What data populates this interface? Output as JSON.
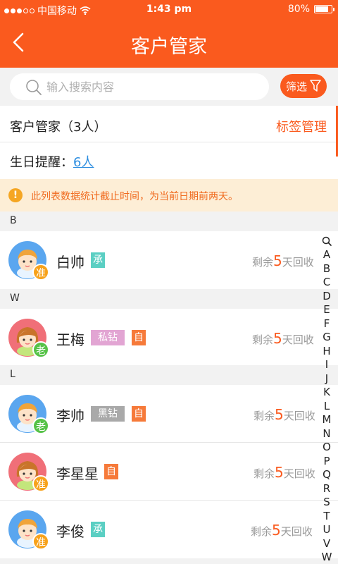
{
  "status_bar": {
    "carrier": "中国移动",
    "time": "1:43 pm",
    "battery_text": "80%",
    "battery_level": 0.8,
    "signal_dots_filled": 3,
    "signal_dots_total": 5,
    "icons": [
      "signal-dots-icon",
      "wifi-icon",
      "battery-icon"
    ]
  },
  "nav": {
    "title": "客户管家",
    "back_icon": "chevron-left-icon"
  },
  "search": {
    "placeholder": "输入搜索内容",
    "value": "",
    "filter_label": "筛选",
    "icons": [
      "search-icon",
      "filter-funnel-icon"
    ]
  },
  "summary": {
    "title": "客户管家（3人）",
    "tag_manage": "标签管理",
    "birthday_label": "生日提醒：",
    "birthday_count": "6人"
  },
  "notice": {
    "icon": "!",
    "text": "此列表数据统计截止时间，为当前日期前两天。"
  },
  "sections": [
    {
      "letter": "B",
      "items": [
        {
          "name": "白帅",
          "avatar_badge": "准",
          "tags": [
            "承"
          ],
          "remain_prefix": "剩余",
          "remain_days": "5",
          "remain_suffix": "天回收"
        }
      ]
    },
    {
      "letter": "W",
      "items": [
        {
          "name": "王梅",
          "avatar_badge": "老",
          "tags": [
            "私钻",
            "自"
          ],
          "remain_prefix": "剩余",
          "remain_days": "5",
          "remain_suffix": "天回收"
        }
      ]
    },
    {
      "letter": "L",
      "items": [
        {
          "name": "李帅",
          "avatar_badge": "老",
          "tags": [
            "黑钻",
            "自"
          ],
          "remain_prefix": "剩余",
          "remain_days": "5",
          "remain_suffix": "天回收"
        },
        {
          "name": "李星星",
          "avatar_badge": "准",
          "tags": [
            "自"
          ],
          "remain_prefix": "剩余",
          "remain_days": "5",
          "remain_suffix": "天回收"
        },
        {
          "name": "李俊",
          "avatar_badge": "准",
          "tags": [
            "承"
          ],
          "remain_prefix": "剩余",
          "remain_days": "5",
          "remain_suffix": "天回收"
        }
      ]
    }
  ],
  "index_bar": [
    "A",
    "B",
    "C",
    "D",
    "E",
    "F",
    "G",
    "H",
    "I",
    "J",
    "K",
    "L",
    "M",
    "N",
    "O",
    "P",
    "Q",
    "R",
    "S",
    "T",
    "U",
    "V",
    "W"
  ],
  "colors": {
    "primary": "#fa5a1e",
    "link_blue": "#2e8ee0",
    "notice_bg": "#fdeed6",
    "tag_cheng": "#5bcfc3",
    "tag_sizuan": "#e2a5d3",
    "tag_heizuan": "#a9a9a9",
    "tag_zi": "#f67a3a",
    "badge_orange": "#f7a21b",
    "badge_green": "#56c248"
  }
}
